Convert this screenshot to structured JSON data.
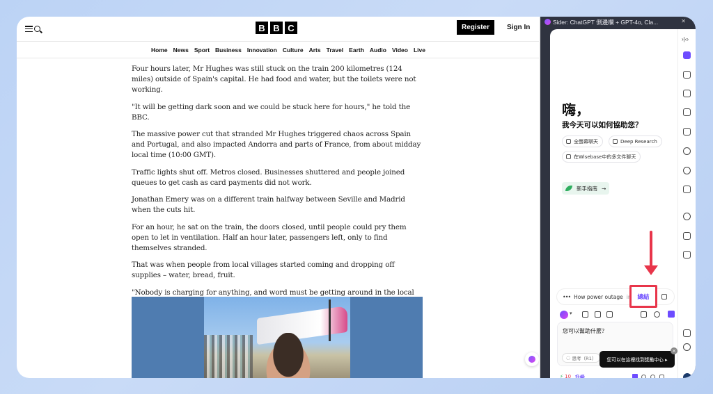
{
  "bbc": {
    "logo": [
      "B",
      "B",
      "C"
    ],
    "register_label": "Register",
    "signin_label": "Sign In",
    "nav": [
      "Home",
      "News",
      "Sport",
      "Business",
      "Innovation",
      "Culture",
      "Arts",
      "Travel",
      "Earth",
      "Audio",
      "Video",
      "Live"
    ],
    "paragraphs": [
      "Four hours later, Mr Hughes was still stuck on the train 200 kilometres (124 miles) outside of Spain's capital. He had food and water, but the toilets were not working.",
      "\"It will be getting dark soon and we could be stuck here for hours,\" he told the BBC.",
      "The massive power cut that stranded Mr Hughes triggered chaos across Spain and Portugal, and also impacted Andorra and parts of France, from about midday local time (10:00 GMT).",
      "Traffic lights shut off. Metros closed. Businesses shuttered and people joined queues to get cash as card payments did not work.",
      "Jonathan Emery was on a different train halfway between Seville and Madrid when the cuts hit.",
      "For an hour, he sat on the train, the doors closed, until people could pry them open to let in ventilation. Half an hour later, passengers left, only to find themselves stranded.",
      "That was when people from local villages started coming and dropping off supplies – water, bread, fruit.",
      "\"Nobody is charging for anything, and word must be getting around in the local town because people just keep coming,\" he said."
    ]
  },
  "sider": {
    "window_title": "Sider: ChatGPT 側邊欄 + GPT-4o, Cla...",
    "greeting": "嗨，",
    "subtitle": "我今天可以如何協助您？",
    "chips": [
      "全螢幕聊天",
      "Deep Research",
      "在Wisebase中的多文件聊天"
    ],
    "guide_label": "新手指南",
    "guide_arrow": "→",
    "prompt_dots": "•••",
    "prompt_text": "How power outage",
    "prompt_fade": "in",
    "summarize_label": "總結",
    "input_placeholder": "您可以幫助什麼？",
    "think_label": "思考（R1）",
    "tooltip": "您可以在這裡找到獎勵中心 ▸",
    "tooltip_close": "×",
    "credits": "10",
    "credits_icon": "⚡",
    "upgrade_label": "升級",
    "collapse_icon": "›|‹›"
  },
  "colors": {
    "accent": "#6d4cff",
    "highlight": "#e8354a",
    "background": "#bcd3f5"
  }
}
